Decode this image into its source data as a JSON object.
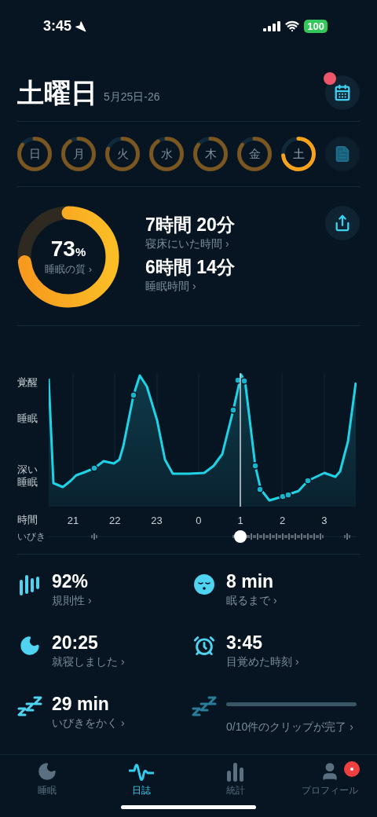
{
  "status_bar": {
    "time": "3:45",
    "battery": "100"
  },
  "header": {
    "title": "土曜日",
    "date": "5月25日-26",
    "notification": true
  },
  "days": [
    {
      "label": "日",
      "level": 0.85,
      "selected": false
    },
    {
      "label": "月",
      "level": 0.9,
      "selected": false
    },
    {
      "label": "火",
      "level": 0.8,
      "selected": false
    },
    {
      "label": "水",
      "level": 0.9,
      "selected": false
    },
    {
      "label": "木",
      "level": 0.85,
      "selected": false
    },
    {
      "label": "金",
      "level": 0.85,
      "selected": false
    },
    {
      "label": "土",
      "level": 0.73,
      "selected": true
    }
  ],
  "summary": {
    "quality": {
      "value": "73",
      "unit": "%",
      "label": "睡眠の質 ›",
      "level": 0.73
    },
    "stats": [
      {
        "value": "7時間 20分",
        "label": "寝床にいた時間 ›"
      },
      {
        "value": "6時間 14分",
        "label": "睡眠時間 ›"
      }
    ]
  },
  "graph": {
    "y_labels": [
      "覚醒",
      "睡眠",
      "深い睡眠"
    ],
    "x_title": "時間",
    "x_labels": [
      "21",
      "22",
      "23",
      "0",
      "1",
      "2",
      "3"
    ],
    "snore_label": "いびき"
  },
  "metrics": [
    {
      "kind": "regularity",
      "value": "92%",
      "label": "規則性 ›"
    },
    {
      "kind": "latency",
      "value": "8 min",
      "label": "眠るまで ›"
    },
    {
      "kind": "bedtime",
      "value": "20:25",
      "label": "就寝しました ›"
    },
    {
      "kind": "wake",
      "value": "3:45",
      "label": "目覚めた時刻 ›"
    },
    {
      "kind": "snore",
      "value": "29 min",
      "label": "いびきをかく ›"
    },
    {
      "kind": "clips",
      "level": 0,
      "label": "0/10件のクリップが完了 ›"
    }
  ],
  "tabs": [
    {
      "label": "睡眠",
      "kind": "sleep",
      "selected": false,
      "badge": false
    },
    {
      "label": "日誌",
      "kind": "journal",
      "selected": true,
      "badge": false
    },
    {
      "label": "統計",
      "kind": "stats",
      "selected": false,
      "badge": false
    },
    {
      "label": "プロフィール",
      "kind": "profile",
      "selected": false,
      "badge": true
    }
  ]
}
